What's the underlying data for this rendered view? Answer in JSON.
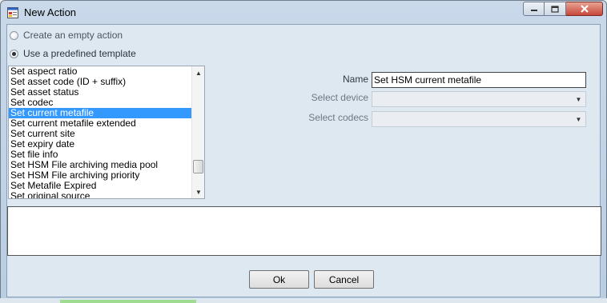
{
  "window": {
    "title": "New Action",
    "icon": "app-form-icon",
    "controls": [
      "minimize-icon",
      "maximize-icon",
      "close-icon"
    ]
  },
  "options": {
    "empty_action": {
      "label": "Create an empty action",
      "checked": false
    },
    "predefined_template": {
      "label": "Use a predefined template",
      "checked": true
    }
  },
  "template_list": {
    "items": [
      "Set aspect ratio",
      "Set asset code (ID + suffix)",
      "Set asset status",
      "Set codec",
      "Set current metafile",
      "Set current metafile extended",
      "Set current site",
      "Set expiry date",
      "Set file info",
      "Set HSM File archiving media pool",
      "Set HSM File archiving priority",
      "Set Metafile Expired",
      "Set original source"
    ],
    "selected": "Set current metafile"
  },
  "form": {
    "name_label": "Name",
    "name_value": "Set HSM current metafile",
    "device_label": "Select device",
    "device_value": "",
    "codecs_label": "Select codecs",
    "codecs_value": ""
  },
  "buttons": {
    "ok": "Ok",
    "cancel": "Cancel"
  },
  "colors": {
    "selection": "#3399ff",
    "dialog_bg": "#dde8f0"
  }
}
